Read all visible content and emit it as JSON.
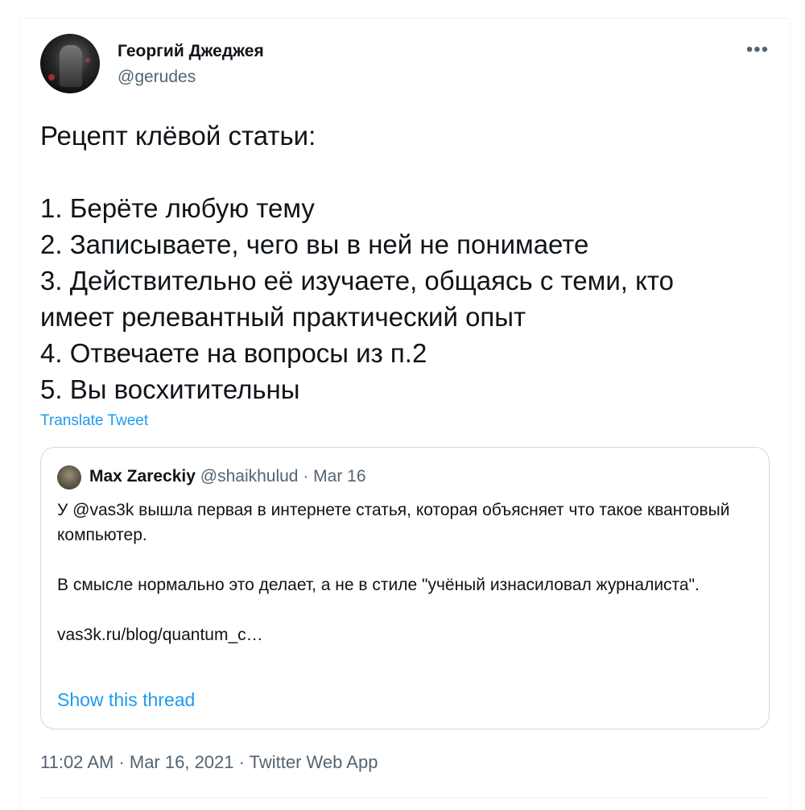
{
  "author": {
    "name": "Георгий Джеджея",
    "handle": "@gerudes"
  },
  "more_icon": "more-horizontal-icon",
  "tweet": {
    "lines": [
      "Рецепт клёвой статьи:",
      "",
      "1. Берёте любую тему",
      "2. Записываете, чего вы в ней не понимаете",
      "3. Действительно её изучаете, общаясь с теми, кто",
      "имеет релевантный практический опыт",
      "4. Отвечаете на вопросы из п.2",
      "5. Вы восхитительны"
    ],
    "translate_label": "Translate Tweet"
  },
  "quote": {
    "name": "Max Zareckiy",
    "handle": "@shaikhulud",
    "separator": " · ",
    "date": "Mar 16",
    "paragraphs": [
      "У @vas3k вышла первая в интернете статья, которая объясняет что такое квантовый компьютер.",
      "В смысле нормально это делает, а не в стиле \"учёный изнасиловал журналиста\".",
      "vas3k.ru/blog/quantum_c…"
    ],
    "show_thread_label": "Show this thread"
  },
  "footer": {
    "timestamp": "11:02 AM · Mar 16, 2021 · Twitter Web App"
  },
  "colors": {
    "text": "#0f1419",
    "secondary": "#536471",
    "link": "#1d9bf0",
    "border": "#cfd9de"
  }
}
